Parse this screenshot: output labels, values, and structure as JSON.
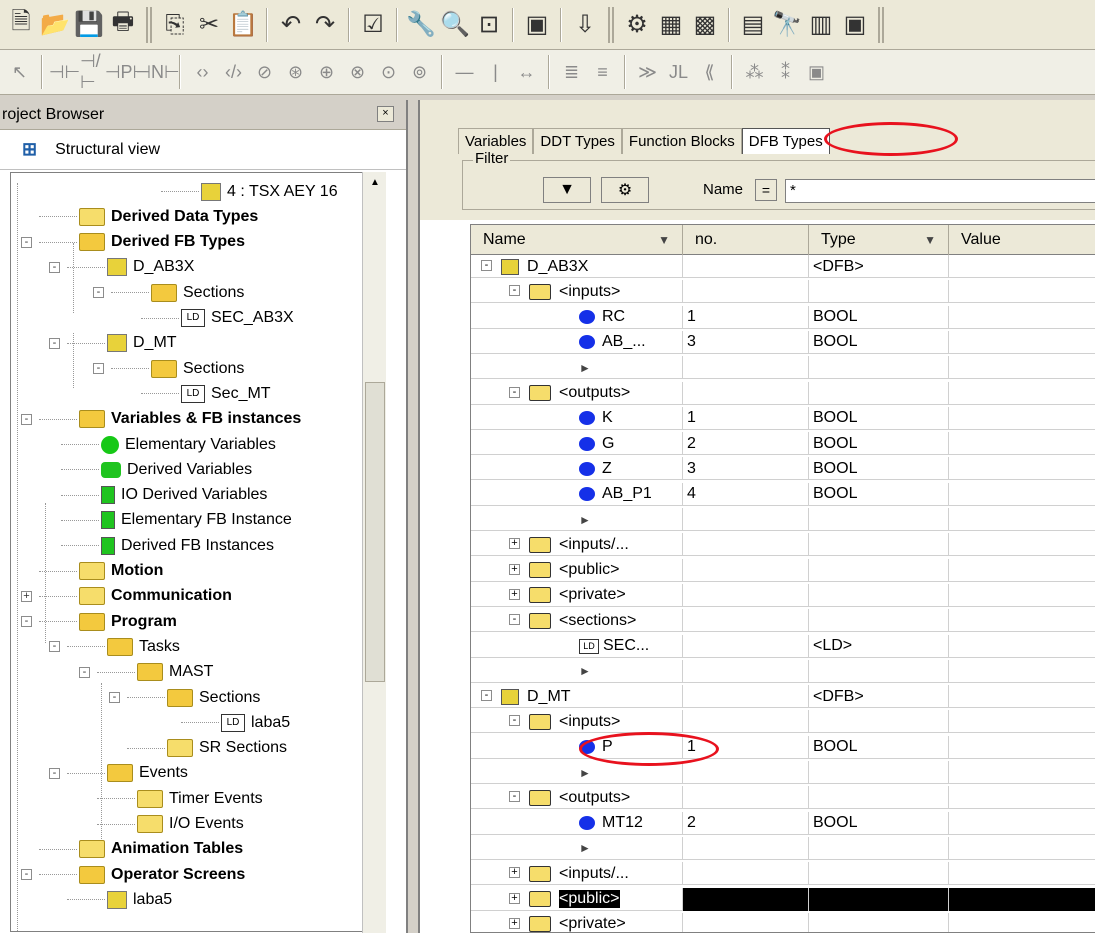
{
  "toolbar_row1": {
    "icons": [
      "new-document-icon",
      "open-folder-icon",
      "save-icon",
      "print-icon",
      "copy-icon",
      "cut-icon",
      "paste-icon",
      "undo-icon",
      "redo-icon",
      "validate-icon",
      "build-icon",
      "analyze-icon",
      "project-icon",
      "screen-icon",
      "transfer-icon",
      "connect-icon",
      "plc-icon",
      "plc-run-icon",
      "window-icon",
      "binoculars-icon",
      "table-icon",
      "browser-icon"
    ]
  },
  "toolbar_row2": {
    "icons": [
      "pointer-icon",
      "contact-no-icon",
      "contact-nc-icon",
      "contact-p-icon",
      "contact-n-icon",
      "coil-icon",
      "coil-neg-icon",
      "coil-set-icon",
      "coil-reset-icon",
      "coil-p-icon",
      "coil-n-icon",
      "coil-halt-icon",
      "coil-call-icon",
      "hline-icon",
      "vline-icon",
      "hlink-icon",
      "oper-icon",
      "comp-icon",
      "jump-icon",
      "label-icon",
      "return-icon",
      "ffb-icon",
      "ffb2-icon",
      "ffb3-icon",
      "ffb4-icon"
    ]
  },
  "browser": {
    "title": "roject Browser",
    "view_label": "Structural view",
    "items": [
      {
        "label": "4 : TSX AEY 16"
      },
      {
        "label": "Derived Data Types"
      },
      {
        "label": "Derived FB Types"
      },
      {
        "label": "D_AB3X"
      },
      {
        "label": "Sections"
      },
      {
        "label": "SEC_AB3X"
      },
      {
        "label": "D_MT"
      },
      {
        "label": "Sections"
      },
      {
        "label": "Sec_MT"
      },
      {
        "label": "Variables & FB instances"
      },
      {
        "label": "Elementary Variables"
      },
      {
        "label": "Derived Variables"
      },
      {
        "label": "IO Derived Variables"
      },
      {
        "label": "Elementary FB Instance"
      },
      {
        "label": "Derived FB Instances"
      },
      {
        "label": "Motion"
      },
      {
        "label": "Communication"
      },
      {
        "label": "Program"
      },
      {
        "label": "Tasks"
      },
      {
        "label": "MAST"
      },
      {
        "label": "Sections"
      },
      {
        "label": "laba5"
      },
      {
        "label": "SR Sections"
      },
      {
        "label": "Events"
      },
      {
        "label": "Timer Events"
      },
      {
        "label": "I/O Events"
      },
      {
        "label": "Animation Tables"
      },
      {
        "label": "Operator Screens"
      },
      {
        "label": "laba5"
      }
    ]
  },
  "main": {
    "tabs": [
      "Variables",
      "DDT Types",
      "Function Blocks",
      "DFB Types"
    ],
    "active_tab": "DFB Types",
    "filter_label": "Filter",
    "name_label": "Name",
    "name_op": "=",
    "name_value": "*",
    "columns": [
      "Name",
      "no.",
      "Type",
      "Value"
    ],
    "rows": [
      {
        "name": "D_AB3X",
        "no": "",
        "type": "<DFB>",
        "value": ""
      },
      {
        "name": "<inputs>",
        "no": "",
        "type": "",
        "value": ""
      },
      {
        "name": "RC",
        "no": "1",
        "type": "BOOL",
        "value": ""
      },
      {
        "name": "AB_...",
        "no": "3",
        "type": "BOOL",
        "value": ""
      },
      {
        "name": "",
        "no": "",
        "type": "",
        "value": ""
      },
      {
        "name": "<outputs>",
        "no": "",
        "type": "",
        "value": ""
      },
      {
        "name": "K",
        "no": "1",
        "type": "BOOL",
        "value": ""
      },
      {
        "name": "G",
        "no": "2",
        "type": "BOOL",
        "value": ""
      },
      {
        "name": "Z",
        "no": "3",
        "type": "BOOL",
        "value": ""
      },
      {
        "name": "AB_P1",
        "no": "4",
        "type": "BOOL",
        "value": ""
      },
      {
        "name": "",
        "no": "",
        "type": "",
        "value": ""
      },
      {
        "name": "<inputs/...",
        "no": "",
        "type": "",
        "value": ""
      },
      {
        "name": "<public>",
        "no": "",
        "type": "",
        "value": ""
      },
      {
        "name": "<private>",
        "no": "",
        "type": "",
        "value": ""
      },
      {
        "name": "<sections>",
        "no": "",
        "type": "",
        "value": ""
      },
      {
        "name": "SEC...",
        "no": "",
        "type": "<LD>",
        "value": ""
      },
      {
        "name": "",
        "no": "",
        "type": "",
        "value": ""
      },
      {
        "name": "D_MT",
        "no": "",
        "type": "<DFB>",
        "value": ""
      },
      {
        "name": "<inputs>",
        "no": "",
        "type": "",
        "value": ""
      },
      {
        "name": "P",
        "no": "1",
        "type": "BOOL",
        "value": ""
      },
      {
        "name": "",
        "no": "",
        "type": "",
        "value": ""
      },
      {
        "name": "<outputs>",
        "no": "",
        "type": "",
        "value": ""
      },
      {
        "name": "MT12",
        "no": "2",
        "type": "BOOL",
        "value": ""
      },
      {
        "name": "",
        "no": "",
        "type": "",
        "value": ""
      },
      {
        "name": "<inputs/...",
        "no": "",
        "type": "",
        "value": ""
      },
      {
        "name": "<public>",
        "no": "",
        "type": "",
        "value": ""
      },
      {
        "name": "<private>",
        "no": "",
        "type": "",
        "value": ""
      }
    ]
  },
  "colors": {
    "highlight": "#e8121e",
    "selection": "#000000",
    "dot": "#1530e8",
    "folder": "#f6dd6b"
  }
}
